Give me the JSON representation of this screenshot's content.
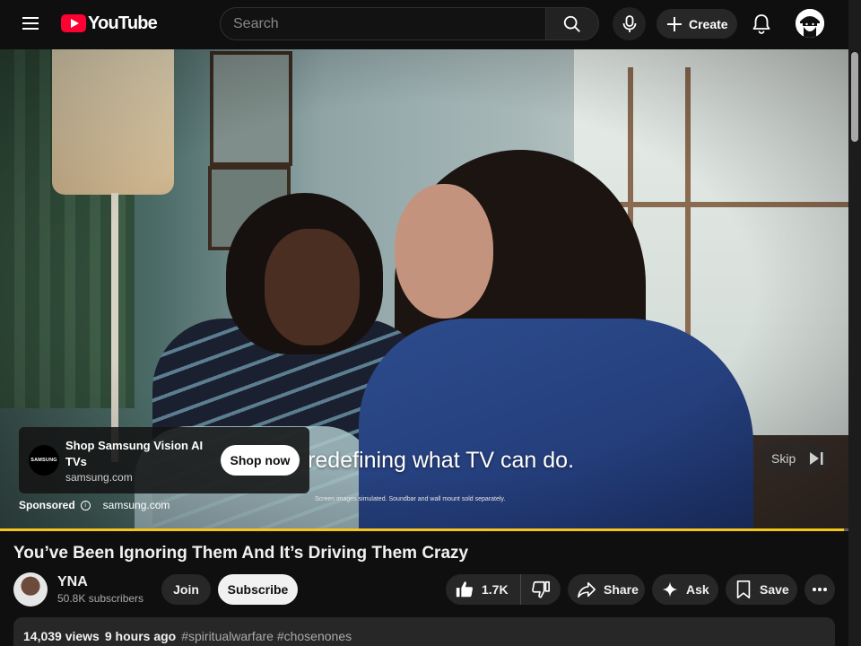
{
  "header": {
    "logo_text": "YouTube",
    "search_placeholder": "Search",
    "create_label": "Create"
  },
  "player": {
    "ad_caption": "are redefining what TV can do.",
    "ad_fineprint": "Screen images simulated. Soundbar and wall mount sold separately.",
    "ad_card": {
      "logo_text": "SAMSUNG",
      "title": "Shop Samsung Vision AI TVs",
      "domain": "samsung.com",
      "cta_label": "Shop now"
    },
    "sponsored_label": "Sponsored",
    "sponsored_domain": "samsung.com",
    "skip_label": "Skip",
    "progress_fraction": 0.995,
    "progress_color": "#f5c518"
  },
  "video": {
    "title": "You’ve Been Ignoring Them And It’s Driving Them Crazy",
    "channel_name": "YNA",
    "subscribers": "50.8K subscribers",
    "join_label": "Join",
    "subscribe_label": "Subscribe",
    "like_count": "1.7K",
    "share_label": "Share",
    "ask_label": "Ask",
    "save_label": "Save"
  },
  "description": {
    "views": "14,039 views",
    "age": "9 hours ago",
    "tags": "#spiritualwarfare #chosenones"
  },
  "icons": {
    "menu": "hamburger-icon",
    "search": "search-icon",
    "mic": "mic-icon",
    "create": "plus-icon",
    "notifications": "bell-icon",
    "info": "info-icon",
    "skip": "skip-next-icon",
    "like": "thumbs-up-icon",
    "dislike": "thumbs-down-icon",
    "share": "share-arrow-icon",
    "ask": "sparkle-icon",
    "save": "bookmark-icon",
    "more": "more-horizontal-icon"
  }
}
